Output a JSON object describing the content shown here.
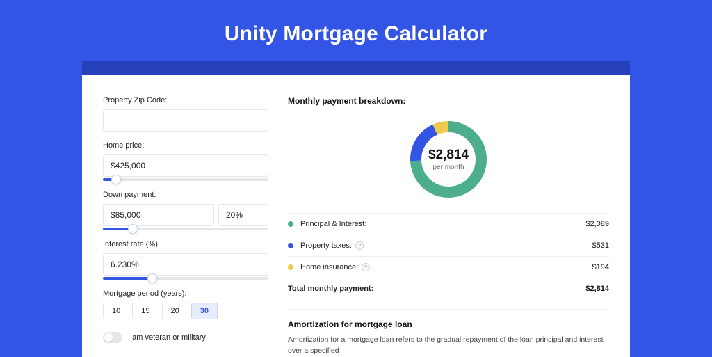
{
  "header": {
    "title": "Unity Mortgage Calculator"
  },
  "form": {
    "zip": {
      "label": "Property Zip Code:",
      "value": ""
    },
    "home_price": {
      "label": "Home price:",
      "value": "$425,000",
      "slider_pct": 8
    },
    "down_payment": {
      "label": "Down payment:",
      "amount": "$85,000",
      "percent": "20%",
      "slider_pct": 18
    },
    "interest": {
      "label": "Interest rate (%):",
      "value": "6.230%",
      "slider_pct": 30
    },
    "period": {
      "label": "Mortgage period (years):",
      "options": [
        "10",
        "15",
        "20",
        "30"
      ],
      "selected": "30"
    },
    "veteran": {
      "label": "I am veteran or military",
      "checked": false
    }
  },
  "breakdown": {
    "title": "Monthly payment breakdown:",
    "center_amount": "$2,814",
    "center_sub": "per month",
    "items": [
      {
        "label": "Principal & Interest:",
        "value": "$2,089",
        "color": "#4cae8c",
        "frac": 0.742,
        "help": false
      },
      {
        "label": "Property taxes:",
        "value": "$531",
        "color": "#3355e6",
        "frac": 0.189,
        "help": true
      },
      {
        "label": "Home insurance:",
        "value": "$194",
        "color": "#f0c94f",
        "frac": 0.069,
        "help": true
      }
    ],
    "total": {
      "label": "Total monthly payment:",
      "value": "$2,814"
    }
  },
  "amortization": {
    "title": "Amortization for mortgage loan",
    "body": "Amortization for a mortgage loan refers to the gradual repayment of the loan principal and interest over a specified"
  },
  "chart_data": {
    "type": "pie",
    "title": "Monthly payment breakdown",
    "categories": [
      "Principal & Interest",
      "Property taxes",
      "Home insurance"
    ],
    "values": [
      2089,
      531,
      194
    ],
    "colors": [
      "#4cae8c",
      "#3355e6",
      "#f0c94f"
    ],
    "total": 2814,
    "center_label": "$2,814 per month"
  }
}
